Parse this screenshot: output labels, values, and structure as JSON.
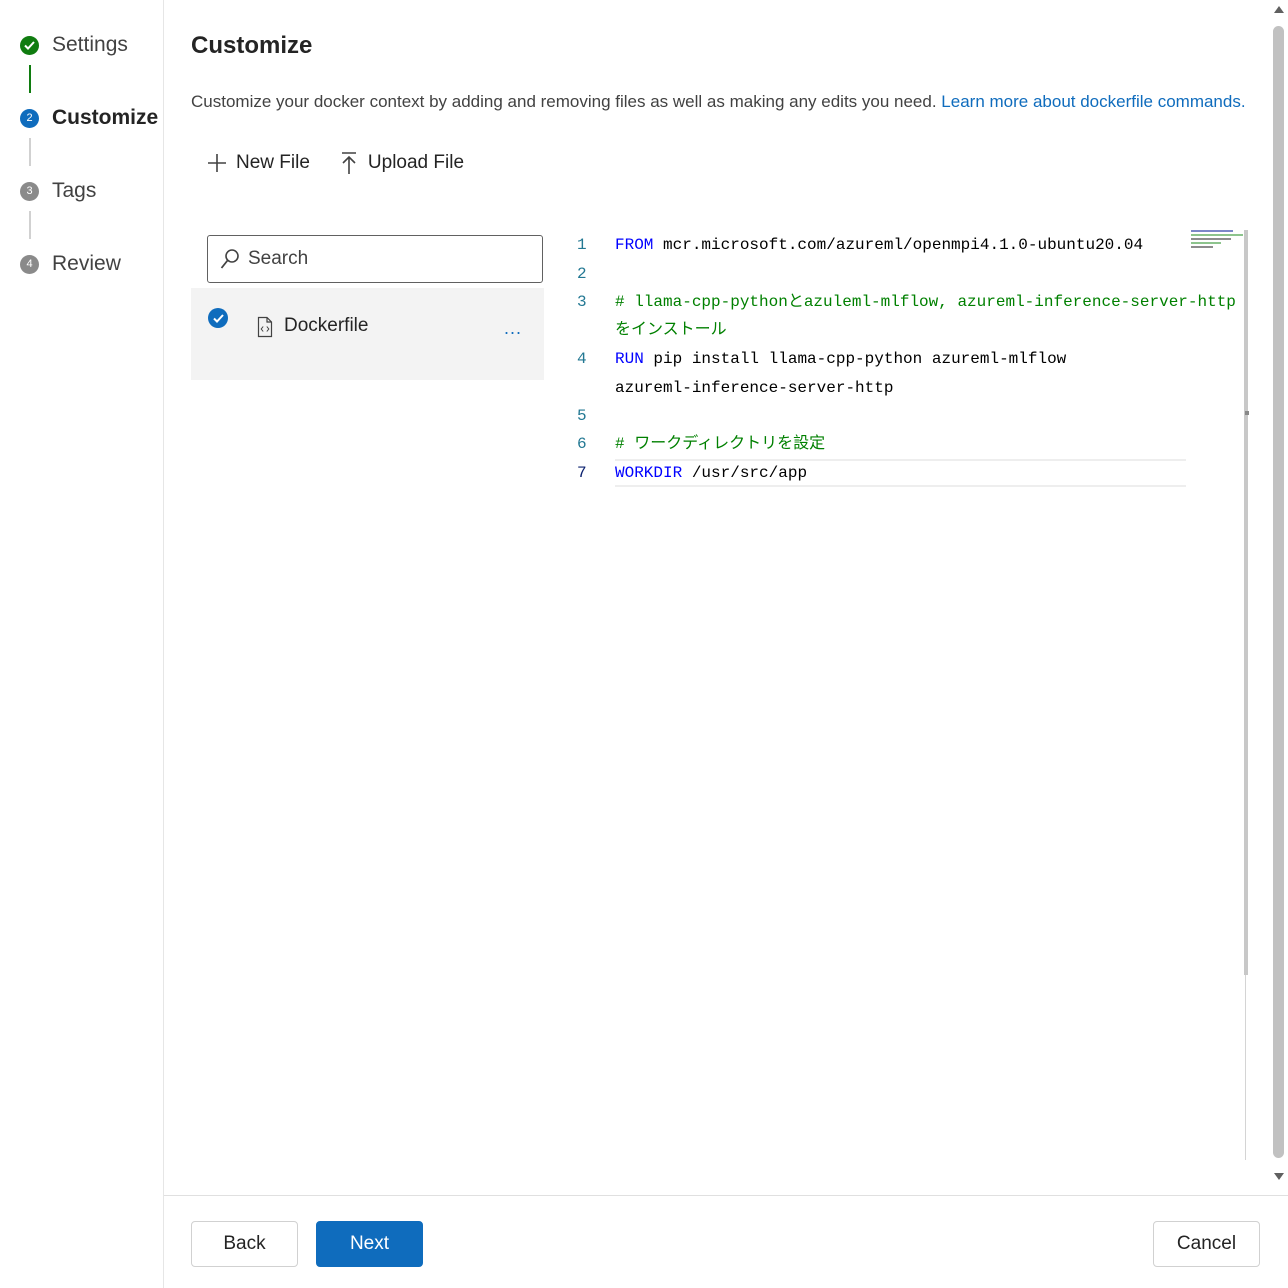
{
  "steps": [
    {
      "label": "Settings",
      "status": "done"
    },
    {
      "label": "Customize",
      "number": "2",
      "status": "active"
    },
    {
      "label": "Tags",
      "number": "3",
      "status": "pending"
    },
    {
      "label": "Review",
      "number": "4",
      "status": "pending"
    }
  ],
  "header": {
    "title": "Customize",
    "description": "Customize your docker context by adding and removing files as well as making any edits you need.",
    "link_text": "Learn more about dockerfile commands."
  },
  "toolbar": {
    "new_file": "New File",
    "upload_file": "Upload File"
  },
  "search": {
    "placeholder": "Search"
  },
  "files": [
    {
      "name": "Dockerfile",
      "selected": true,
      "more": "..."
    }
  ],
  "editor": {
    "lines": [
      {
        "number": "1",
        "keyword": "FROM",
        "text": " mcr.microsoft.com/azureml/openmpi4.1.0-ubuntu20.04"
      },
      {
        "number": "2",
        "text": ""
      },
      {
        "number": "3",
        "comment": "# llama-cpp-pythonとazuleml-mlflow, azureml-inference-server-http",
        "comment_cont": "をインストール"
      },
      {
        "number": "4",
        "keyword": "RUN",
        "text": " pip install llama-cpp-python azureml-mlflow",
        "text_cont": "azureml-inference-server-http"
      },
      {
        "number": "5",
        "text": ""
      },
      {
        "number": "6",
        "comment": "# ワークディレクトリを設定"
      },
      {
        "number": "7",
        "keyword": "WORKDIR",
        "text": " /usr/src/app"
      }
    ]
  },
  "footer": {
    "back": "Back",
    "next": "Next",
    "cancel": "Cancel"
  },
  "colors": {
    "accent": "#0f6cbd",
    "done": "#107c10",
    "keyword": "#0000ff",
    "comment": "#008000",
    "line_number": "#237893"
  },
  "icons": [
    "check-icon",
    "plus-icon",
    "upload-icon",
    "search-icon",
    "file-code-icon",
    "more-icon"
  ]
}
